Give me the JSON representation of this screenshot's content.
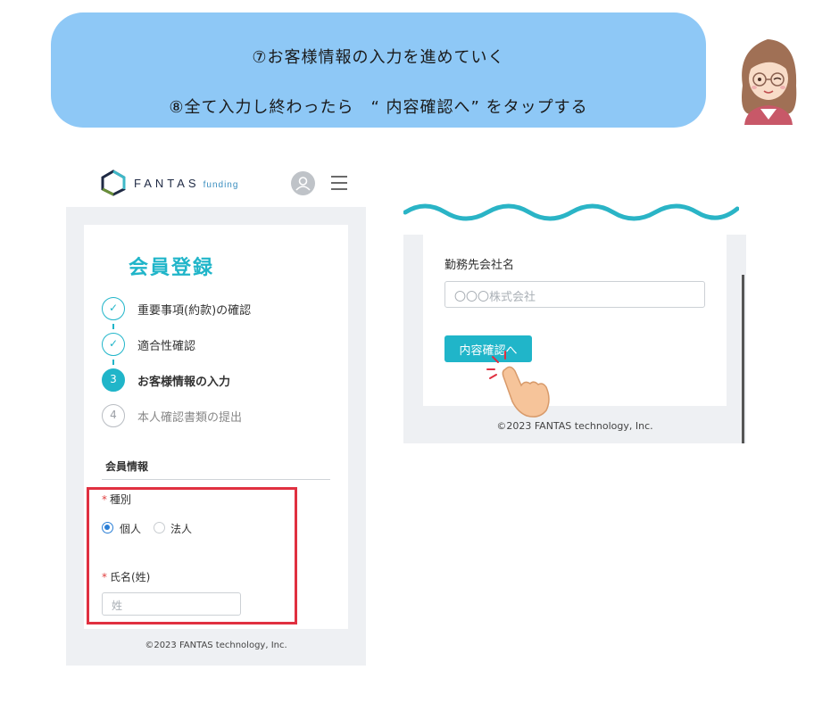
{
  "banner": {
    "line1": "⑦お客様情報の入力を進めていく",
    "line2": "⑧全て入力し終わったら　“ 内容確認へ” をタップする"
  },
  "left_screen": {
    "brand": "FANTAS",
    "brand_sub": "funding",
    "page_title": "会員登録",
    "steps": [
      {
        "number": "✓",
        "label": "重要事項(約款)の確認",
        "state": "done"
      },
      {
        "number": "✓",
        "label": "適合性確認",
        "state": "done"
      },
      {
        "number": "3",
        "label": "お客様情報の入力",
        "state": "current"
      },
      {
        "number": "4",
        "label": "本人確認書類の提出",
        "state": "pending"
      }
    ],
    "section_title": "会員情報",
    "type_field": {
      "required_mark": "*",
      "label": "種別",
      "options": [
        "個人",
        "法人"
      ],
      "selected": "個人"
    },
    "name_field": {
      "required_mark": "*",
      "label": "氏名(姓)",
      "placeholder": "姓"
    },
    "footer": "©2023 FANTAS technology, Inc."
  },
  "right_screen": {
    "company_label": "勤務先会社名",
    "company_placeholder": "〇〇〇株式会社",
    "confirm_button": "内容確認へ",
    "footer": "©2023 FANTAS technology, Inc."
  },
  "colors": {
    "banner": "#8ec8f6",
    "accent": "#20b5c9",
    "highlight": "#e03040",
    "required": "#e04040",
    "radio_selected": "#2b7fd6"
  },
  "icons": [
    "user-icon",
    "hamburger-menu-icon",
    "check-icon",
    "pointing-hand-icon",
    "fantas-logo-icon"
  ]
}
